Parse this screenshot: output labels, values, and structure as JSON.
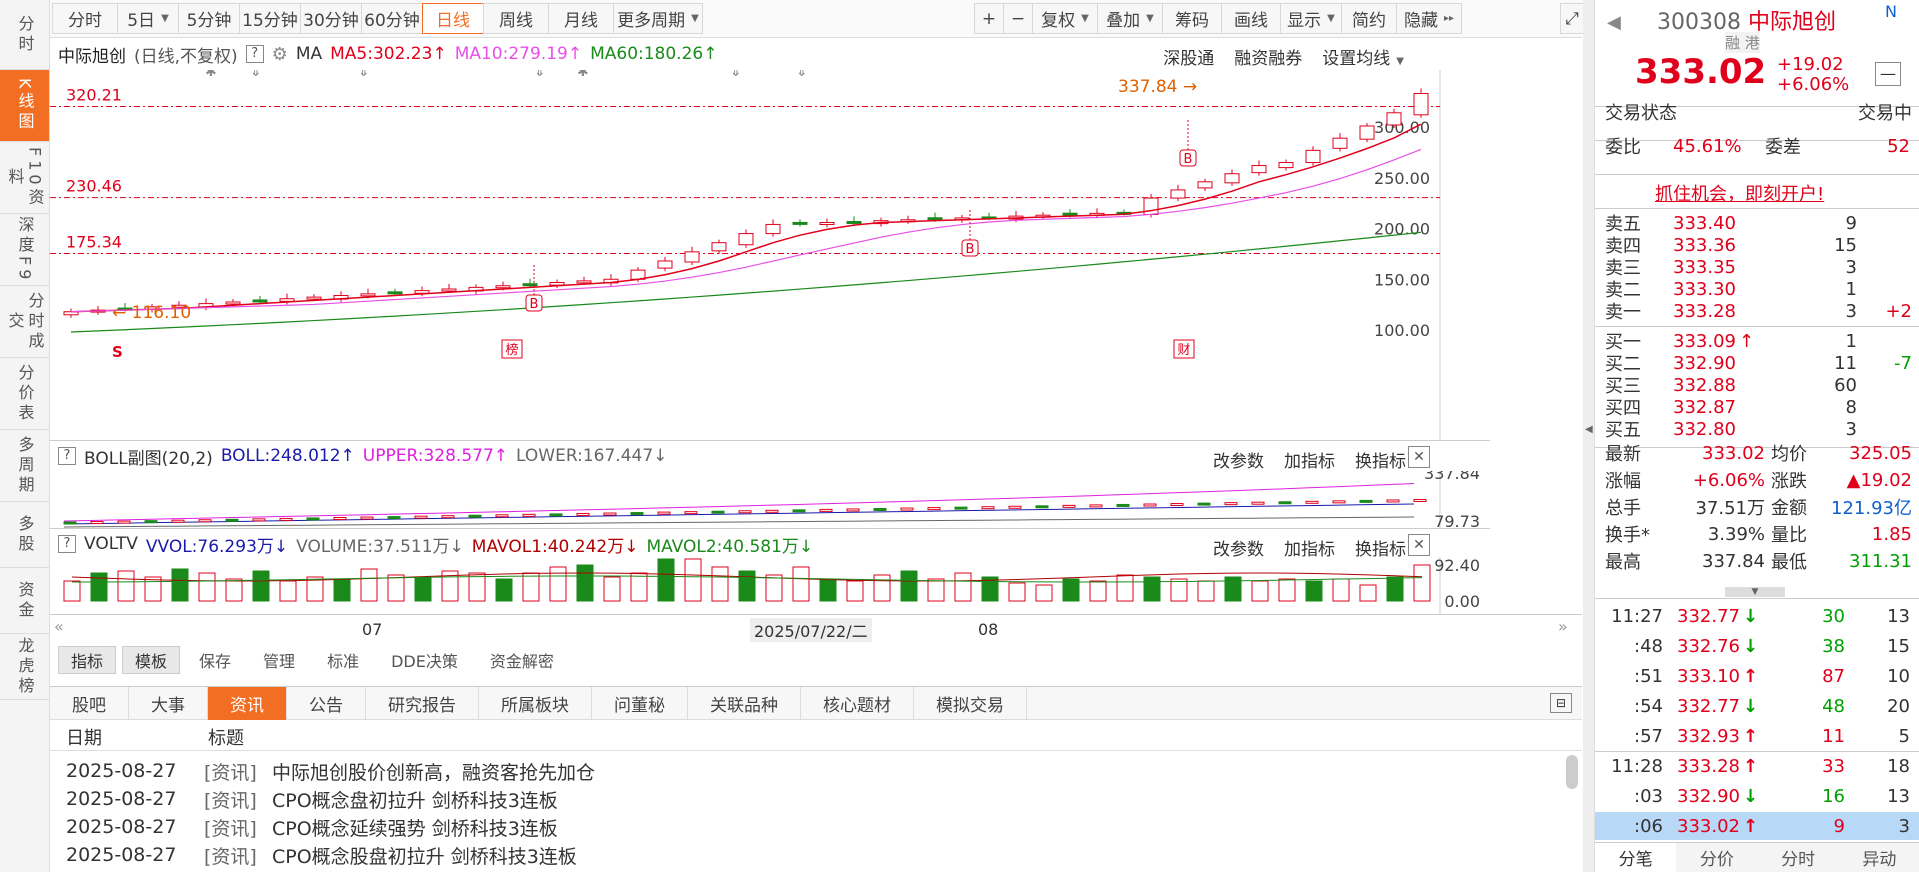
{
  "lefttabs": [
    "分时",
    "K线图",
    "F10资料",
    "深度F9",
    "分时成交",
    "分价表",
    "多周期",
    "多股",
    "资金",
    "龙虎榜"
  ],
  "periods": [
    "分时",
    "5日",
    "5分钟",
    "15分钟",
    "30分钟",
    "60分钟",
    "日线",
    "周线",
    "月线",
    "更多周期"
  ],
  "tools": [
    "+",
    "−",
    "复权",
    "叠加",
    "筹码",
    "画线",
    "显示",
    "简约",
    "隐藏"
  ],
  "info": {
    "name": "中际旭创",
    "mode": "(日线,不复权)",
    "ma_label": "MA",
    "ma5": "MA5:302.23",
    "ma10": "MA10:279.19",
    "ma60": "MA60:180.26",
    "links": [
      "深股通",
      "融资融券",
      "设置均线"
    ]
  },
  "chart": {
    "colors": {
      "up": "#e0001b",
      "down": "#1a8a1a",
      "ma5": "#e0001b",
      "ma10": "#e84ee8",
      "ma60": "#1a8a1a",
      "dash": "#e0001b"
    },
    "yticks": [
      "300.00",
      "250.00",
      "200.00",
      "150.00",
      "100.00"
    ],
    "levels": [
      "320.21",
      "230.46",
      "175.34"
    ],
    "high_label": "337.84",
    "low_label": "116.10",
    "markers": {
      "s": "S",
      "bang": "榜",
      "cai": "财",
      "b": "B"
    }
  },
  "boll": {
    "title": "BOLL副图(20,2)",
    "boll": "BOLL:248.012",
    "upper": "UPPER:328.577",
    "lower": "LOWER:167.447",
    "links": [
      "改参数",
      "加指标",
      "换指标"
    ],
    "ticks": [
      "337.84",
      "79.73"
    ]
  },
  "vol": {
    "title": "VOLTV",
    "vvol": "VVOL:76.293万",
    "volume": "VOLUME:37.511万",
    "mavol1": "MAVOL1:40.242万",
    "mavol2": "MAVOL2:40.581万",
    "links": [
      "改参数",
      "加指标",
      "换指标"
    ],
    "ticks": [
      "92.40",
      "0.00"
    ]
  },
  "timeaxis": {
    "m1": "07",
    "date": "2025/07/22/二",
    "m2": "08"
  },
  "bottomtabs": [
    "指标",
    "模板",
    "保存",
    "管理",
    "标准",
    "DDE决策",
    "资金解密"
  ],
  "newstabs": [
    "股吧",
    "大事",
    "资讯",
    "公告",
    "研究报告",
    "所属板块",
    "问董秘",
    "关联品种",
    "核心题材",
    "模拟交易"
  ],
  "newshead": {
    "date": "日期",
    "title": "标题"
  },
  "news": [
    {
      "date": "2025-08-27",
      "tag": "[资讯]",
      "title": "中际旭创股价创新高，融资客抢先加仓"
    },
    {
      "date": "2025-08-27",
      "tag": "[资讯]",
      "title": "CPO概念盘初拉升 剑桥科技3连板"
    },
    {
      "date": "2025-08-27",
      "tag": "[资讯]",
      "title": "CPO概念延续强势 剑桥科技3连板"
    },
    {
      "date": "2025-08-27",
      "tag": "[资讯]",
      "title": "CPO概念股盘初拉升 剑桥科技3连板"
    }
  ],
  "quote": {
    "code": "300308",
    "name": "中际旭创",
    "n": "N",
    "tags": "融 港",
    "price": "333.02",
    "chg": "+19.02",
    "pct": "+6.06%",
    "status_label": "交易状态",
    "status": "交易中",
    "wb_label": "委比",
    "wb": "45.61%",
    "wc_label": "委差",
    "wc": "52",
    "promo": "抓住机会，即刻开户!"
  },
  "asks": [
    {
      "l": "卖五",
      "p": "333.40",
      "v": "9",
      "d": ""
    },
    {
      "l": "卖四",
      "p": "333.36",
      "v": "15",
      "d": ""
    },
    {
      "l": "卖三",
      "p": "333.35",
      "v": "3",
      "d": ""
    },
    {
      "l": "卖二",
      "p": "333.30",
      "v": "1",
      "d": ""
    },
    {
      "l": "卖一",
      "p": "333.28",
      "v": "3",
      "d": "+2"
    }
  ],
  "bids": [
    {
      "l": "买一",
      "p": "333.09",
      "v": "1",
      "d": ""
    },
    {
      "l": "买二",
      "p": "332.90",
      "v": "11",
      "d": "-7"
    },
    {
      "l": "买三",
      "p": "332.88",
      "v": "60",
      "d": ""
    },
    {
      "l": "买四",
      "p": "332.87",
      "v": "8",
      "d": ""
    },
    {
      "l": "买五",
      "p": "332.80",
      "v": "3",
      "d": ""
    }
  ],
  "stats": [
    [
      "最新",
      "333.02",
      "均价",
      "325.05"
    ],
    [
      "涨幅",
      "+6.06%",
      "涨跌",
      "▲19.02"
    ],
    [
      "总手",
      "37.51万",
      "金额",
      "121.93亿"
    ],
    [
      "换手*",
      "3.39%",
      "量比",
      "1.85"
    ],
    [
      "最高",
      "337.84",
      "最低",
      "311.31"
    ]
  ],
  "ticks": [
    {
      "t": "11:27",
      "p": "332.77",
      "a": "↓",
      "v": "30",
      "n": "13"
    },
    {
      "t": ":48",
      "p": "332.76",
      "a": "↓",
      "v": "38",
      "n": "15"
    },
    {
      "t": ":51",
      "p": "333.10",
      "a": "↑",
      "v": "87",
      "n": "10"
    },
    {
      "t": ":54",
      "p": "332.77",
      "a": "↓",
      "v": "48",
      "n": "20"
    },
    {
      "t": ":57",
      "p": "332.93",
      "a": "↑",
      "v": "11",
      "n": "5"
    },
    {
      "t": "11:28",
      "p": "333.28",
      "a": "↑",
      "v": "33",
      "n": "18"
    },
    {
      "t": ":03",
      "p": "332.90",
      "a": "↓",
      "v": "16",
      "n": "13"
    },
    {
      "t": ":06",
      "p": "333.02",
      "a": "↑",
      "v": "9",
      "n": "3"
    }
  ],
  "rtabs": [
    "分笔",
    "分价",
    "分时",
    "异动"
  ]
}
